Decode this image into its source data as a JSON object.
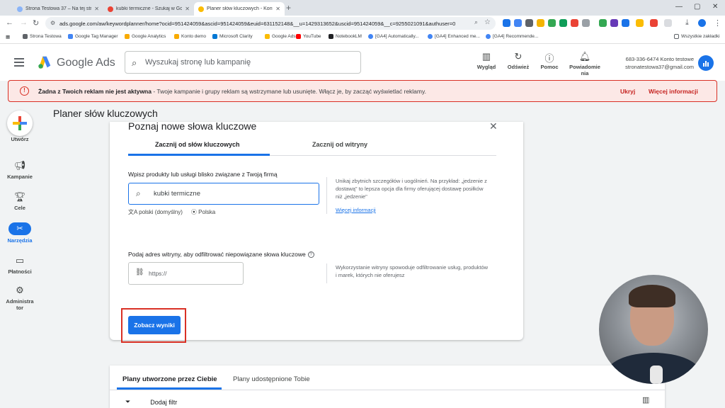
{
  "browser": {
    "tabs": [
      {
        "title": "Strona Testowa 37 – Na tej stro"
      },
      {
        "title": "kubki termiczne - Szukaj w Goo"
      },
      {
        "title": "Planer słów kluczowych - Konto"
      }
    ],
    "url": "ads.google.com/aw/keywordplanner/home?ocid=951424059&ascid=951424059&euid=631152148&__u=1429313652&uscid=951424059&__c=9255021091&authuser=0",
    "bookmarks": [
      "Strona Testowa",
      "Google Tag Manager",
      "Google Analytics",
      "Konto demo",
      "Microsoft Clarity",
      "Google Ads",
      "YouTube",
      "NotebookLM",
      "[GA4] Automatically...",
      "[GA4] Enhanced me...",
      "[GA4] Recommende..."
    ],
    "all_bookmarks": "Wszystkie zakładki"
  },
  "header": {
    "brand": "Google Ads",
    "search_placeholder": "Wyszukaj stronę lub kampanię",
    "actions": [
      {
        "label": "Wygląd",
        "icon": "appearance-icon"
      },
      {
        "label": "Odśwież",
        "icon": "refresh-icon"
      },
      {
        "label": "Pomoc",
        "icon": "help-icon"
      },
      {
        "label": "Powiadomie nia",
        "icon": "bell-icon"
      }
    ],
    "account_id": "683-336-6474 Konto testowe",
    "account_email": "stronatestowa37@gmail.com"
  },
  "alert": {
    "bold": "Żadna z Twoich reklam nie jest aktywna",
    "text": " - Twoje kampanie i grupy reklam są wstrzymane lub usunięte. Włącz je, by zacząć wyświetlać reklamy.",
    "hide": "Ukryj",
    "more": "Więcej informacji"
  },
  "rail": {
    "create": "Utwórz",
    "items": [
      {
        "label": "Kampanie",
        "icon": "megaphone-icon"
      },
      {
        "label": "Cele",
        "icon": "trophy-icon"
      },
      {
        "label": "Narzędzia",
        "icon": "tools-icon"
      },
      {
        "label": "Płatności",
        "icon": "card-icon"
      },
      {
        "label": "Administra tor",
        "icon": "gear-icon"
      }
    ]
  },
  "page": {
    "title": "Planer słów kluczowych"
  },
  "card": {
    "title": "Poznaj nowe słowa kluczowe",
    "tab_keywords": "Zacznij od słów kluczowych",
    "tab_website": "Zacznij od witryny",
    "kw_label": "Wpisz produkty lub usługi blisko związane z Twoją firmą",
    "kw_value": "kubki termiczne",
    "language": "polski (domyślny)",
    "location": "Polska",
    "hint": "Unikaj zbytnich szczegółów i uogólnień. Na przykład: „jedzenie z dostawą\" to lepsza opcja dla firmy oferującej dostawę posiłków niż „jedzenie\"",
    "hint_more": "Więcej informacji",
    "url_label": "Podaj adres witryny, aby odfiltrować niepowiązane słowa kluczowe",
    "url_placeholder": "https://",
    "url_hint": "Wykorzystanie witryny spowoduje odfiltrowanie usług, produktów i marek, których nie oferujesz",
    "results_button": "Zobacz wyniki"
  },
  "plans": {
    "tab_mine": "Plany utworzone przez Ciebie",
    "tab_shared": "Plany udostępnione Tobie",
    "add_filter": "Dodaj filtr"
  },
  "colors": {
    "accent": "#1a73e8",
    "error": "#d93025",
    "alert_bg": "#fce8e6"
  }
}
